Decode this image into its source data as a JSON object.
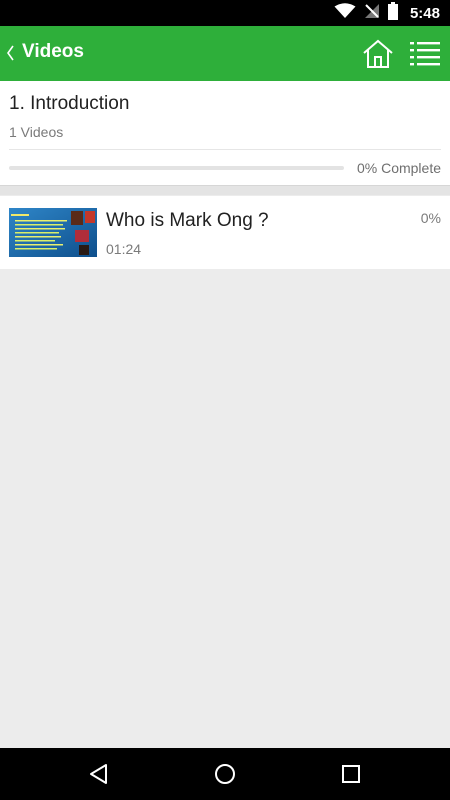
{
  "status_bar": {
    "time": "5:48",
    "icons": [
      "wifi-icon",
      "no-signal-icon",
      "battery-icon"
    ]
  },
  "app_bar": {
    "title": "Videos",
    "icons": [
      "chevron-left-icon",
      "home-icon",
      "list-menu-icon"
    ],
    "color": "#2eaf3a"
  },
  "section": {
    "title": "1. Introduction",
    "video_count": "1 Videos",
    "progress_fraction": 0,
    "progress_label": "0% Complete"
  },
  "videos": [
    {
      "title": "Who is Mark Ong ?",
      "duration": "01:24",
      "percent": "0%",
      "thumbnail": "presentation-slide-thumbnail"
    }
  ],
  "nav_bar": {
    "icons": [
      "back-triangle-icon",
      "home-circle-icon",
      "recents-square-icon"
    ]
  }
}
